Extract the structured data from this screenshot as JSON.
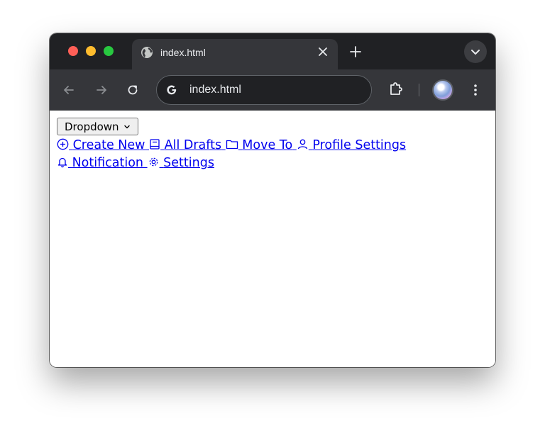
{
  "browser": {
    "tab_title": "index.html",
    "address": "index.html"
  },
  "page": {
    "dropdown_label": "Dropdown",
    "links": [
      {
        "label": "Create New",
        "icon": "plus-circle-icon"
      },
      {
        "label": "All Drafts",
        "icon": "book-icon"
      },
      {
        "label": "Move To",
        "icon": "folder-icon"
      },
      {
        "label": "Profile Settings",
        "icon": "user-icon"
      },
      {
        "label": "Notification",
        "icon": "bell-icon"
      },
      {
        "label": "Settings",
        "icon": "gear-icon"
      }
    ]
  },
  "colors": {
    "link": "#0000ee",
    "tab_bar": "#202124",
    "toolbar": "#35363a"
  }
}
